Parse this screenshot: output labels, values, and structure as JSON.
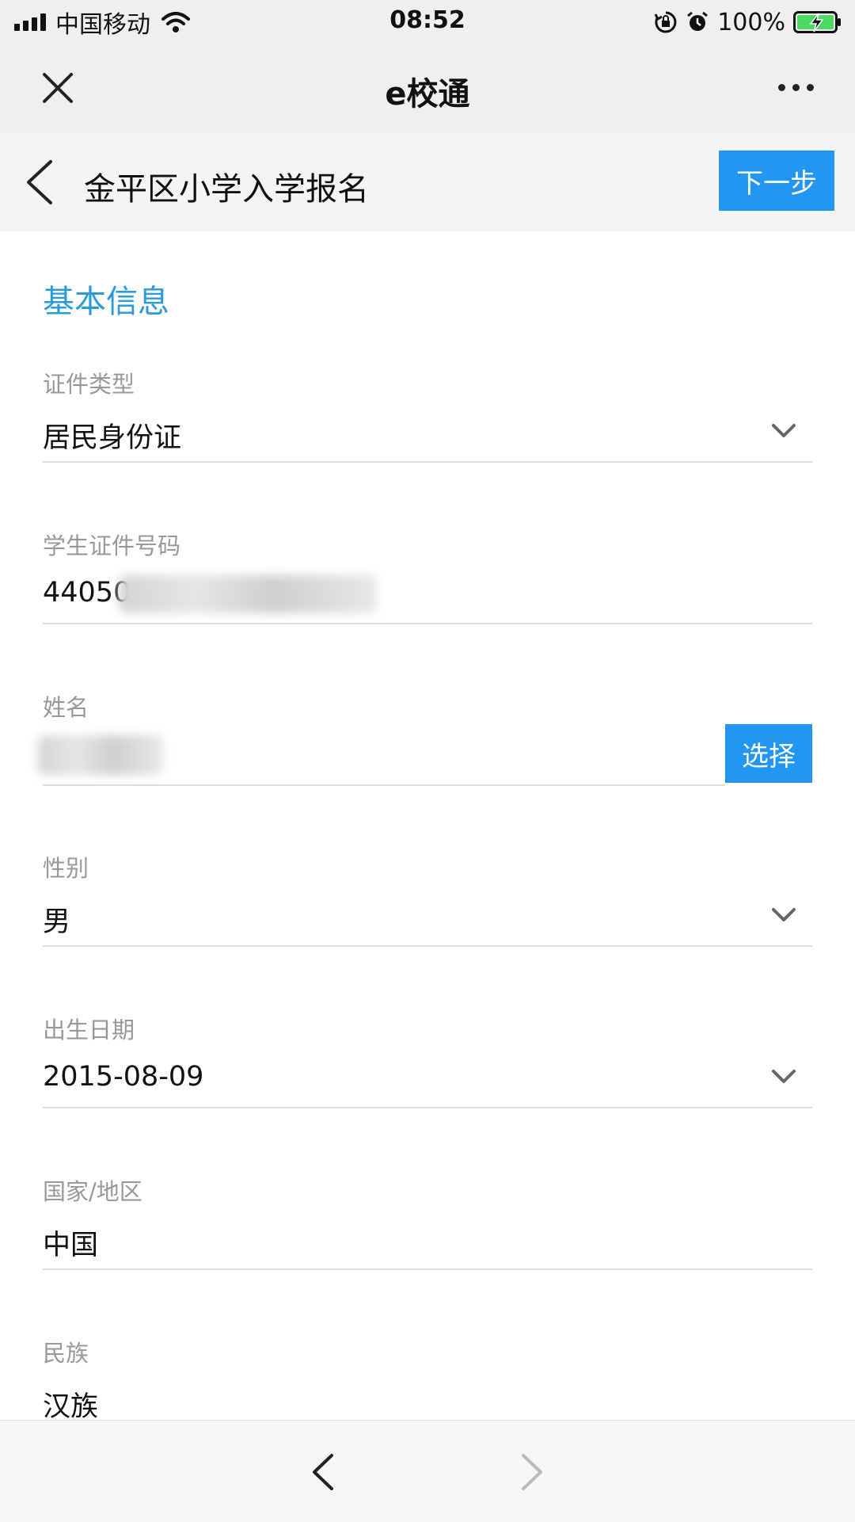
{
  "status_bar": {
    "carrier": "中国移动",
    "time": "08:52",
    "battery_percent": "100%"
  },
  "title_bar": {
    "title": "e校通"
  },
  "page_header": {
    "title": "金平区小学入学报名",
    "next_label": "下一步"
  },
  "form": {
    "section_title": "基本信息",
    "fields": [
      {
        "label": "证件类型",
        "value": "居民身份证",
        "type": "select"
      },
      {
        "label": "学生证件号码",
        "value": "44050",
        "type": "text"
      },
      {
        "label": "姓名",
        "value": "",
        "type": "text",
        "button_label": "选择"
      },
      {
        "label": "性别",
        "value": "男",
        "type": "select"
      },
      {
        "label": "出生日期",
        "value": "2015-08-09",
        "type": "select"
      },
      {
        "label": "国家/地区",
        "value": "中国",
        "type": "text"
      },
      {
        "label": "民族",
        "value": "汉族",
        "type": "text"
      }
    ]
  },
  "icons": {
    "close": "close-icon",
    "more": "more-icon",
    "back": "chevron-left-icon",
    "dropdown": "chevron-down-icon",
    "nav_back": "chevron-left-icon",
    "nav_forward": "chevron-right-icon"
  },
  "colors": {
    "accent": "#2196f3",
    "section_title": "#2a9bd8",
    "label": "#999999"
  }
}
